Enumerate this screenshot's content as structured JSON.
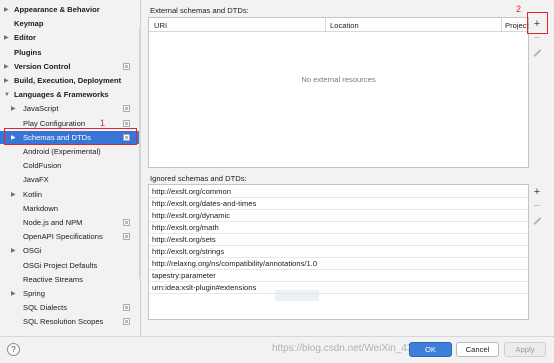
{
  "sidebar": {
    "items": [
      {
        "label": "Appearance & Behavior",
        "bold": true,
        "arrow": "▶",
        "icon": false
      },
      {
        "label": "Keymap",
        "bold": true,
        "arrow": "",
        "icon": false
      },
      {
        "label": "Editor",
        "bold": true,
        "arrow": "▶",
        "icon": false
      },
      {
        "label": "Plugins",
        "bold": true,
        "arrow": "",
        "icon": false
      },
      {
        "label": "Version Control",
        "bold": true,
        "arrow": "▶",
        "icon": true
      },
      {
        "label": "Build, Execution, Deployment",
        "bold": true,
        "arrow": "▶",
        "icon": false
      },
      {
        "label": "Languages & Frameworks",
        "bold": true,
        "arrow": "▼",
        "icon": false
      },
      {
        "label": "JavaScript",
        "bold": false,
        "arrow": "▶",
        "icon": true
      },
      {
        "label": "Play Configuration",
        "bold": false,
        "arrow": "",
        "icon": true
      },
      {
        "label": "Schemas and DTDs",
        "bold": false,
        "arrow": "▶",
        "icon": true,
        "selected": true
      },
      {
        "label": "Android (Experimental)",
        "bold": false,
        "arrow": "",
        "icon": false
      },
      {
        "label": "ColdFusion",
        "bold": false,
        "arrow": "",
        "icon": false
      },
      {
        "label": "JavaFX",
        "bold": false,
        "arrow": "",
        "icon": false
      },
      {
        "label": "Kotlin",
        "bold": false,
        "arrow": "▶",
        "icon": false
      },
      {
        "label": "Markdown",
        "bold": false,
        "arrow": "",
        "icon": false
      },
      {
        "label": "Node.js and NPM",
        "bold": false,
        "arrow": "",
        "icon": true
      },
      {
        "label": "OpenAPI Specifications",
        "bold": false,
        "arrow": "",
        "icon": true
      },
      {
        "label": "OSGi",
        "bold": false,
        "arrow": "▶",
        "icon": false
      },
      {
        "label": "OSGi Project Defaults",
        "bold": false,
        "arrow": "",
        "icon": false
      },
      {
        "label": "Reactive Streams",
        "bold": false,
        "arrow": "",
        "icon": false
      },
      {
        "label": "Spring",
        "bold": false,
        "arrow": "▶",
        "icon": false
      },
      {
        "label": "SQL Dialects",
        "bold": false,
        "arrow": "",
        "icon": true
      },
      {
        "label": "SQL Resolution Scopes",
        "bold": false,
        "arrow": "",
        "icon": true
      }
    ]
  },
  "annotations": {
    "first": "1",
    "second": "2"
  },
  "external": {
    "title": "External schemas and DTDs:",
    "columns": [
      "URI",
      "Location",
      "Project"
    ],
    "empty_text": "No external resources"
  },
  "ignored": {
    "title": "Ignored schemas and DTDs:",
    "rows": [
      "http://exslt.org/common",
      "http://exslt.org/dates-and-times",
      "http://exslt.org/dynamic",
      "http://exslt.org/math",
      "http://exslt.org/sets",
      "http://exslt.org/strings",
      "http://relaxng.org/ns/compatibility/annotations/1.0",
      "tapestry:parameter",
      "urn:idea:xslt-plugin#extensions"
    ]
  },
  "toolbar": {
    "add_glyph": "+",
    "remove_glyph": "−"
  },
  "footer": {
    "help": "?",
    "ok": "OK",
    "cancel": "Cancel",
    "apply": "Apply",
    "watermark": "https://blog.csdn.net/WeiXin_43848889"
  },
  "colors": {
    "selection": "#3875d6",
    "annotation": "#e0232e",
    "ok_button": "#3d7fdb"
  }
}
